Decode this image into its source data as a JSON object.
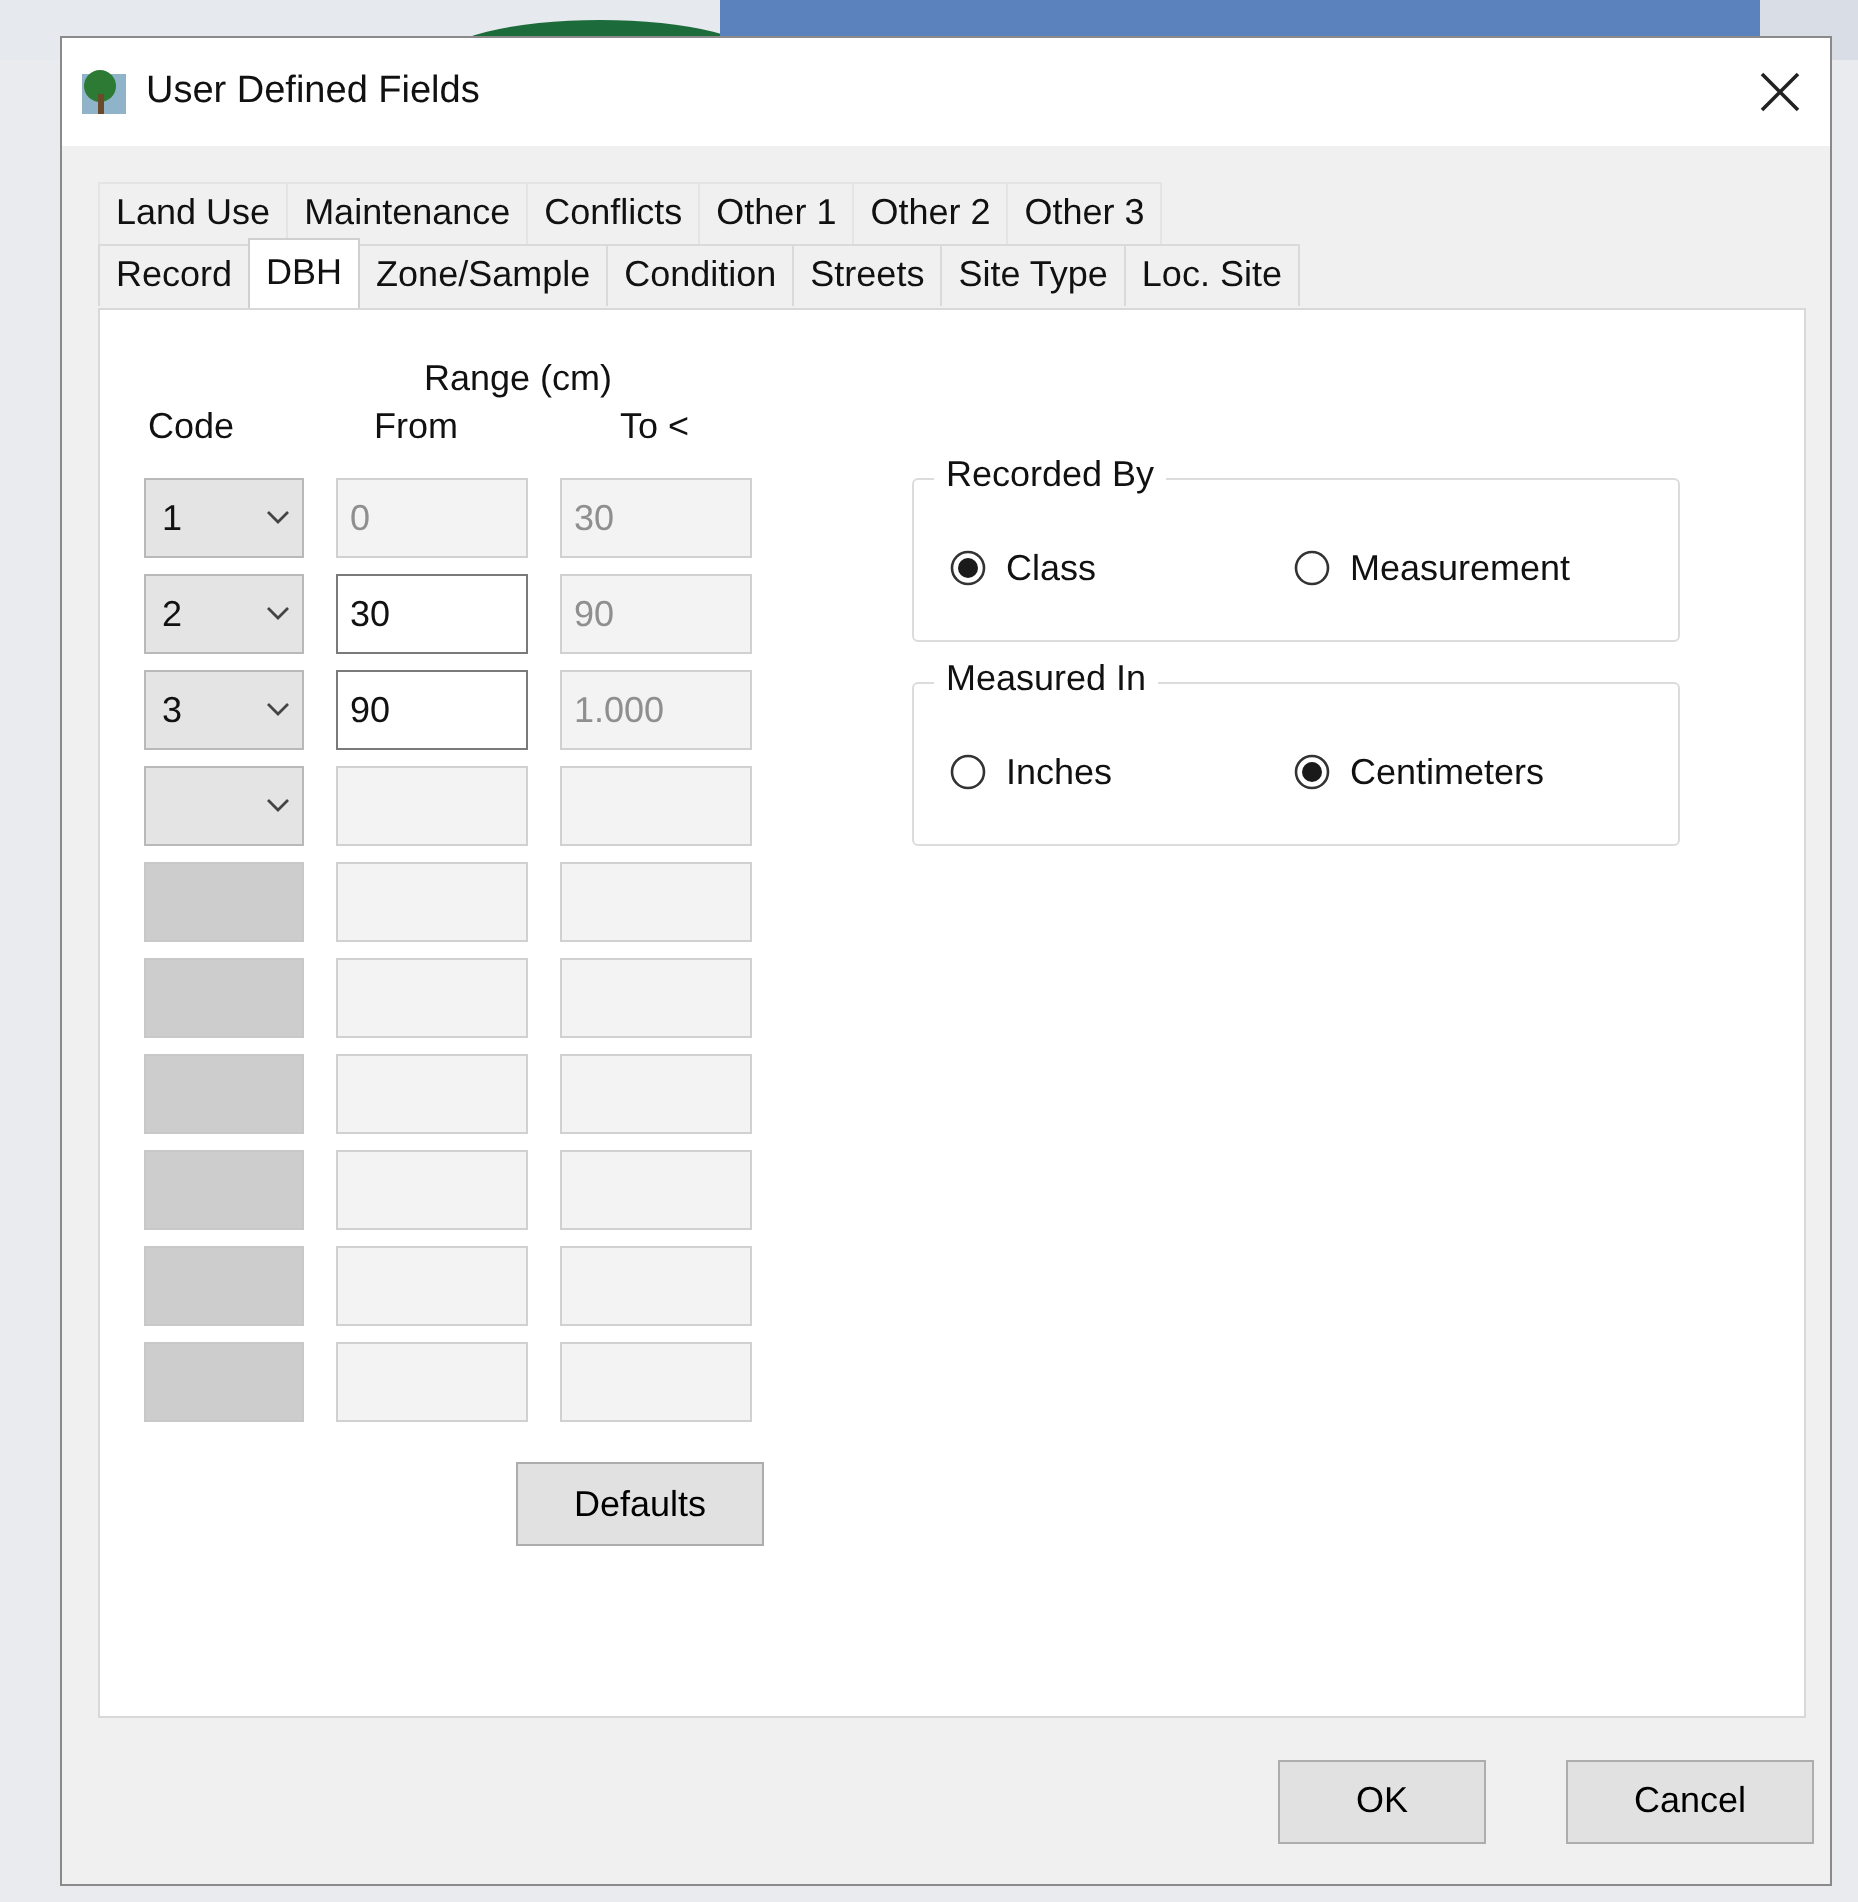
{
  "window": {
    "title": "User Defined Fields"
  },
  "tab_rows": [
    [
      {
        "label": "Land Use",
        "selected": false
      },
      {
        "label": "Maintenance",
        "selected": false
      },
      {
        "label": "Conflicts",
        "selected": false
      },
      {
        "label": "Other 1",
        "selected": false
      },
      {
        "label": "Other 2",
        "selected": false
      },
      {
        "label": "Other 3",
        "selected": false
      }
    ],
    [
      {
        "label": "Record",
        "selected": false
      },
      {
        "label": "DBH",
        "selected": true
      },
      {
        "label": "Zone/Sample",
        "selected": false
      },
      {
        "label": "Condition",
        "selected": false
      },
      {
        "label": "Streets",
        "selected": false
      },
      {
        "label": "Site Type",
        "selected": false
      },
      {
        "label": "Loc. Site",
        "selected": false
      }
    ]
  ],
  "range_header": "Range (cm)",
  "columns": [
    "Code",
    "From",
    "To <"
  ],
  "rows": [
    {
      "code": {
        "value": "1",
        "disabled": false
      },
      "from": {
        "value": "0",
        "disabled": true
      },
      "to": {
        "value": "30",
        "disabled": true
      }
    },
    {
      "code": {
        "value": "2",
        "disabled": false
      },
      "from": {
        "value": "30",
        "disabled": false
      },
      "to": {
        "value": "90",
        "disabled": true
      }
    },
    {
      "code": {
        "value": "3",
        "disabled": false
      },
      "from": {
        "value": "90",
        "disabled": false
      },
      "to": {
        "value": "1.000",
        "disabled": true
      }
    },
    {
      "code": {
        "disabled": false
      },
      "from": {
        "disabled": true
      },
      "to": {
        "disabled": true
      }
    },
    {
      "code": {
        "disabled": true
      },
      "from": {
        "disabled": true
      },
      "to": {
        "disabled": true
      }
    },
    {
      "code": {
        "disabled": true
      },
      "from": {
        "disabled": true
      },
      "to": {
        "disabled": true
      }
    },
    {
      "code": {
        "disabled": true
      },
      "from": {
        "disabled": true
      },
      "to": {
        "disabled": true
      }
    },
    {
      "code": {
        "disabled": true
      },
      "from": {
        "disabled": true
      },
      "to": {
        "disabled": true
      }
    },
    {
      "code": {
        "disabled": true
      },
      "from": {
        "disabled": true
      },
      "to": {
        "disabled": true
      }
    },
    {
      "code": {
        "disabled": true
      },
      "from": {
        "disabled": true
      },
      "to": {
        "disabled": true
      }
    }
  ],
  "defaults_button": "Defaults",
  "groups": [
    {
      "title": "Recorded By",
      "options": [
        {
          "label": "Class",
          "selected": true
        },
        {
          "label": "Measurement",
          "selected": false
        }
      ]
    },
    {
      "title": "Measured In",
      "options": [
        {
          "label": "Inches",
          "selected": false
        },
        {
          "label": "Centimeters",
          "selected": true
        }
      ]
    }
  ],
  "buttons": [
    "OK",
    "Cancel"
  ]
}
